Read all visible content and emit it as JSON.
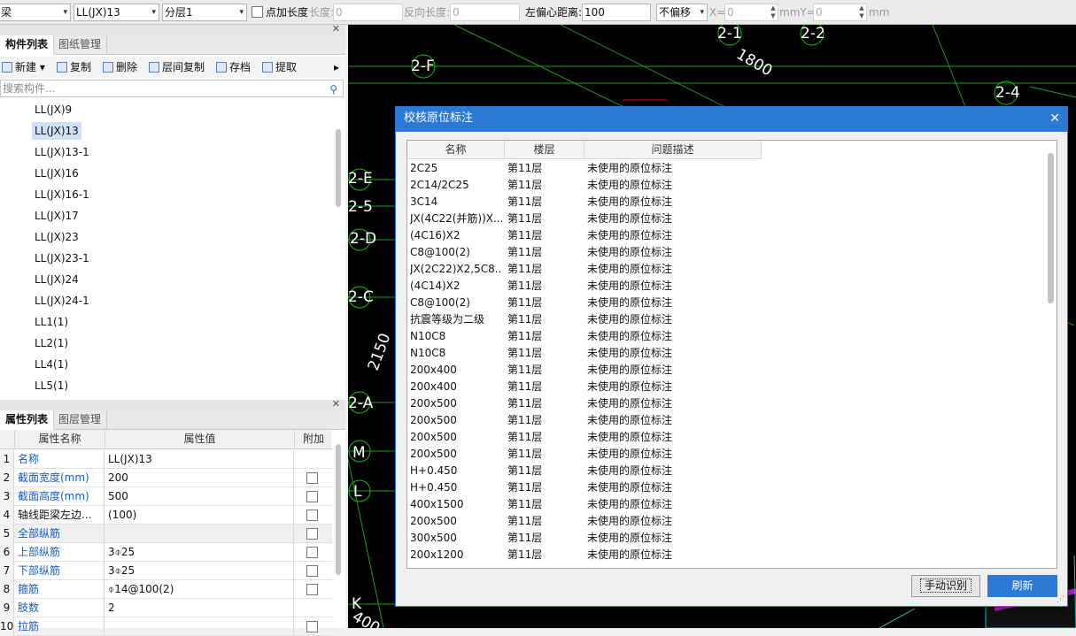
{
  "toolbar": {
    "type_combo": "梁",
    "component_combo": "LL(JX)13",
    "layer_combo": "分层1",
    "point_length_check": "点加长度",
    "length_label": "长度:",
    "length_value": "0",
    "reverse_length_label": "反向长度:",
    "reverse_length_value": "0",
    "left_offset_label": "左偏心距离:",
    "left_offset_value": "100",
    "offset_mode": "不偏移",
    "x_label": "X=",
    "x_value": "0",
    "mm_y_label": "mmY=",
    "y_value": "0",
    "mm_label": "mm"
  },
  "component_panel": {
    "tabs": [
      "构件列表",
      "图纸管理"
    ],
    "actions": {
      "new": "新建",
      "copy": "复制",
      "delete": "删除",
      "layer_copy": "层间复制",
      "save": "存档",
      "extract": "提取",
      "more": "▸"
    },
    "search_placeholder": "搜索构件...",
    "items": [
      "LL(JX)9",
      "LL(JX)13",
      "LL(JX)13-1",
      "LL(JX)16",
      "LL(JX)16-1",
      "LL(JX)17",
      "LL(JX)23",
      "LL(JX)23-1",
      "LL(JX)24",
      "LL(JX)24-1",
      "LL1(1)",
      "LL2(1)",
      "LL4(1)",
      "LL5(1)"
    ],
    "selected": "LL(JX)13"
  },
  "property_panel": {
    "tabs": [
      "属性列表",
      "图层管理"
    ],
    "headers": {
      "name": "属性名称",
      "value": "属性值",
      "extra": "附加"
    },
    "rows": [
      {
        "n": "1",
        "name": "名称",
        "value": "LL(JX)13",
        "blue": true,
        "check": false
      },
      {
        "n": "2",
        "name": "截面宽度(mm)",
        "value": "200",
        "blue": true,
        "check": true
      },
      {
        "n": "3",
        "name": "截面高度(mm)",
        "value": "500",
        "blue": true,
        "check": true
      },
      {
        "n": "4",
        "name": "轴线距梁左边...",
        "value": "(100)",
        "blue": false,
        "check": true
      },
      {
        "n": "5",
        "name": "全部纵筋",
        "value": "",
        "blue": true,
        "check": true
      },
      {
        "n": "6",
        "name": "上部纵筋",
        "value": "3⌽25",
        "blue": true,
        "check": true
      },
      {
        "n": "7",
        "name": "下部纵筋",
        "value": "3⌽25",
        "blue": true,
        "check": true
      },
      {
        "n": "8",
        "name": "箍筋",
        "value": "⌽14@100(2)",
        "blue": true,
        "check": true
      },
      {
        "n": "9",
        "name": "肢数",
        "value": "2",
        "blue": true,
        "check": false
      },
      {
        "n": "10",
        "name": "拉筋",
        "value": "",
        "blue": true,
        "check": true
      }
    ]
  },
  "cad": {
    "labels": [
      {
        "t": "2-1"
      },
      {
        "t": "2-2"
      },
      {
        "t": "2-F"
      },
      {
        "t": "1800"
      },
      {
        "t": "2-4"
      },
      {
        "t": "2-E"
      },
      {
        "t": "2-5"
      },
      {
        "t": "2-D"
      },
      {
        "t": "2-C"
      },
      {
        "t": "2150"
      },
      {
        "t": "2-A"
      },
      {
        "t": "M"
      },
      {
        "t": "L"
      },
      {
        "t": "K"
      },
      {
        "t": "400"
      }
    ]
  },
  "dialog": {
    "title": "校核原位标注",
    "columns": [
      "名称",
      "楼层",
      "问题描述"
    ],
    "rows": [
      [
        "2C25",
        "第11层",
        "未使用的原位标注"
      ],
      [
        "2C14/2C25",
        "第11层",
        "未使用的原位标注"
      ],
      [
        "3C14",
        "第11层",
        "未使用的原位标注"
      ],
      [
        "JX(4C22(并筋))X...",
        "第11层",
        "未使用的原位标注"
      ],
      [
        "(4C16)X2",
        "第11层",
        "未使用的原位标注"
      ],
      [
        "C8@100(2)",
        "第11层",
        "未使用的原位标注"
      ],
      [
        "JX(2C22)X2,5C8...",
        "第11层",
        "未使用的原位标注"
      ],
      [
        "(4C14)X2",
        "第11层",
        "未使用的原位标注"
      ],
      [
        "C8@100(2)",
        "第11层",
        "未使用的原位标注"
      ],
      [
        "抗震等级为二级",
        "第11层",
        "未使用的原位标注"
      ],
      [
        "N10C8",
        "第11层",
        "未使用的原位标注"
      ],
      [
        "N10C8",
        "第11层",
        "未使用的原位标注"
      ],
      [
        "200x400",
        "第11层",
        "未使用的原位标注"
      ],
      [
        "200x400",
        "第11层",
        "未使用的原位标注"
      ],
      [
        "200x500",
        "第11层",
        "未使用的原位标注"
      ],
      [
        "200x500",
        "第11层",
        "未使用的原位标注"
      ],
      [
        "200x500",
        "第11层",
        "未使用的原位标注"
      ],
      [
        "200x500",
        "第11层",
        "未使用的原位标注"
      ],
      [
        "H+0.450",
        "第11层",
        "未使用的原位标注"
      ],
      [
        "H+0.450",
        "第11层",
        "未使用的原位标注"
      ],
      [
        "400x1500",
        "第11层",
        "未使用的原位标注"
      ],
      [
        "200x500",
        "第11层",
        "未使用的原位标注"
      ],
      [
        "300x500",
        "第11层",
        "未使用的原位标注"
      ],
      [
        "200x1200",
        "第11层",
        "未使用的原位标注"
      ]
    ],
    "manual_button": "手动识别",
    "refresh_button": "刷新",
    "close": "✕"
  }
}
